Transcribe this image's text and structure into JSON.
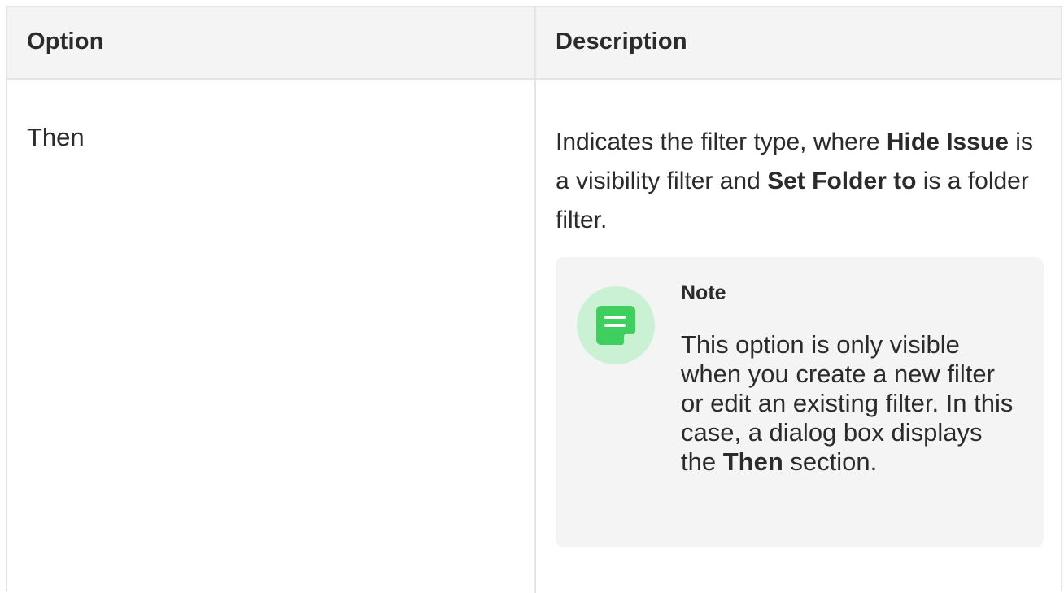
{
  "table": {
    "headers": {
      "option": "Option",
      "description": "Description"
    },
    "rows": [
      {
        "option": "Then",
        "description": {
          "t1": "Indicates the filter type, where ",
          "b1": "Hide Issue",
          "t2": " is a visibility filter and ",
          "b2": "Set Folder to",
          "t3": " is a folder filter."
        },
        "note": {
          "icon": "note-icon",
          "title": "Note",
          "t1": "This option is only visible when you create a new filter or edit an existing filter. In this case, a dialog box displays the ",
          "b1": "Then",
          "t2": " section."
        }
      }
    ]
  },
  "colors": {
    "header_bg": "#f4f4f4",
    "border": "#e4e4e4",
    "note_bg": "#f4f4f4",
    "note_icon_circle": "#cbf1d4",
    "note_icon": "#3fcf5f"
  }
}
